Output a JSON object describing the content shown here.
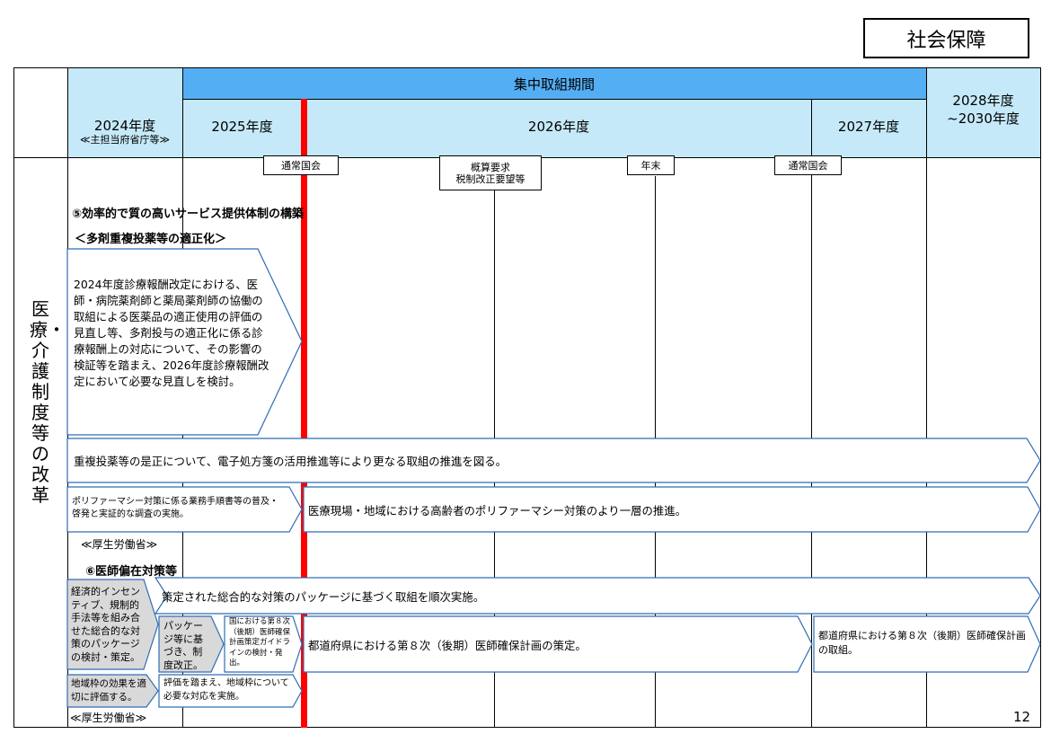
{
  "badge": "社会保障",
  "header": {
    "intensive_period": "集中取組期間",
    "col_2024_year": "2024年度",
    "col_2024_sub": "≪主担当府省庁等≫",
    "col_2025": "2025年度",
    "col_2026": "2026年度",
    "col_2027": "2027年度",
    "col_2028_line1": "2028年度",
    "col_2028_line2": "~2030年度"
  },
  "sidebar_title": "医療・介護制度等の改革",
  "milestones": {
    "m1": "通常国会",
    "m2_line1": "概算要求",
    "m2_line2": "税制改正要望等",
    "m3": "年末",
    "m4": "通常国会"
  },
  "section5": {
    "heading": "⑤効率的で質の高いサービス提供体制の構築",
    "subheading": "＜多剤重複投薬等の適正化＞",
    "box1": "2024年度診療報酬改定における、医師・病院薬剤師と薬局薬剤師の協働の取組による医薬品の適正使用の評価の見直し等、多剤投与の適正化に係る診療報酬上の対応について、その影響の検証等を踏まえ、2026年度診療報酬改定において必要な見直しを検討。",
    "arrow1": "重複投薬等の是正について、電子処方箋の活用推進等により更なる取組の推進を図る。",
    "box2": "ポリファーマシー対策に係る業務手順書等の普及・啓発と実証的な調査の実施。",
    "arrow2": "医療現場・地域における高齢者のポリファーマシー対策のより一層の推進。",
    "ministry": "≪厚生労働省≫"
  },
  "section6": {
    "heading": "⑥医師偏在対策等",
    "box_gray1": "経済的インセンティブ、規制的手法等を組み合せた総合的な対策のパッケージの検討・策定。",
    "arrow_top": "策定された総合的な対策のパッケージに基づく取組を順次実施。",
    "box_gray2": "パッケージ等に基づき、制度改正。",
    "box_small": "国における第８次（後期）医師確保計画策定ガイドラインの検討・発出。",
    "arrow_mid": "都道府県における第８次（後期）医師確保計画の策定。",
    "arrow_right": "都道府県における第８次（後期）医師確保計画の取組。",
    "box_gray3": "地域枠の効果を適切に評価する。",
    "box_bottom": "評価を踏まえ、地域枠について必要な対応を実施。",
    "ministry": "≪厚生労働省≫"
  },
  "page_number": "12"
}
